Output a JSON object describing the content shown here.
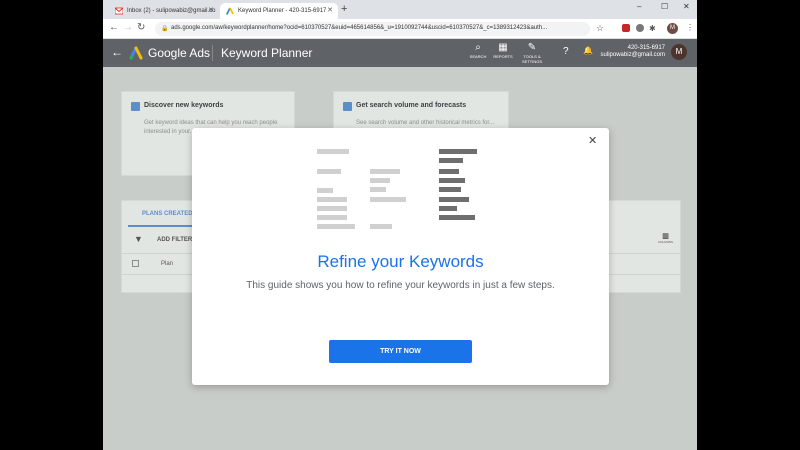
{
  "browser": {
    "tabs": [
      {
        "title": "Inbox (2) - sulipowabiz@gmail.co",
        "active": false
      },
      {
        "title": "Keyword Planner - 420-315-6917",
        "active": true
      }
    ],
    "new_tab": "+",
    "url": "ads.google.com/aw/keywordplanner/home?ocid=610370527&euid=465614856&_u=1910092744&uscid=610370527&_c=1389312423&auth...",
    "account_initial": "M",
    "win_minimize": "–",
    "win_maximize": "☐",
    "win_close": "✕"
  },
  "header": {
    "product": "Google Ads",
    "page": "Keyword Planner",
    "icons": [
      {
        "label": "SEARCH",
        "glyph": "⌕"
      },
      {
        "label": "REPORTS",
        "glyph": "▦"
      },
      {
        "label": "TOOLS & SETTINGS",
        "glyph": "✎"
      }
    ],
    "help_glyph": "?",
    "bell_glyph": "🔔",
    "phone": "420-315-6917",
    "email": "sulipowabiz@gmail.com",
    "avatar": "M"
  },
  "background": {
    "card1": {
      "title": "Discover new keywords",
      "desc": "Get keyword ideas that can help you reach people interested in your..."
    },
    "card2": {
      "title": "Get search volume and forecasts",
      "desc": "See search volume and other historical metrics for..."
    },
    "plans_tab": "PLANS CREATED",
    "add_filter": "ADD FILTER",
    "columns": "COLUMNS",
    "plan_col": "Plan"
  },
  "modal": {
    "title": "Refine your Keywords",
    "subtitle": "This guide shows you how to refine your keywords in just a few steps.",
    "cta": "TRY IT NOW",
    "close": "✕"
  },
  "colors": {
    "accent": "#1a73e8",
    "header_bg": "#5f6368",
    "overlay_bg": "#c8cdc9"
  }
}
